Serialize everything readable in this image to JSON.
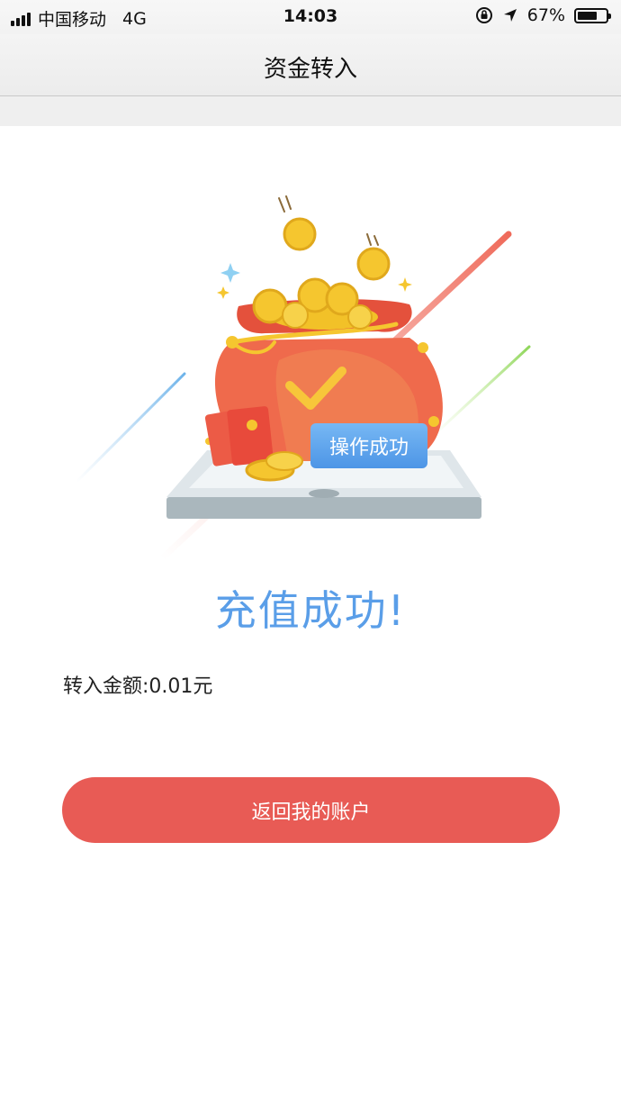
{
  "status_bar": {
    "carrier": "中国移动",
    "network": "4G",
    "time": "14:03",
    "battery_percent": "67%",
    "battery_level": 0.67,
    "icons": [
      "signal-icon",
      "orientation-lock-icon",
      "location-arrow-icon",
      "battery-icon"
    ]
  },
  "nav": {
    "title": "资金转入"
  },
  "illustration": {
    "badge_text": "操作成功",
    "icons": [
      "money-bag-icon",
      "checkmark-icon",
      "coin-icon",
      "red-envelope-icon",
      "phone-icon"
    ]
  },
  "result": {
    "title": "充值成功!",
    "amount_label": "转入金额:",
    "amount_value": "0.01元"
  },
  "actions": {
    "return_label": "返回我的账户"
  },
  "colors": {
    "accent_blue": "#5a9ee8",
    "button_red": "#e85b55",
    "bag_red": "#ef6a4c",
    "coin_gold": "#f5c62f"
  }
}
